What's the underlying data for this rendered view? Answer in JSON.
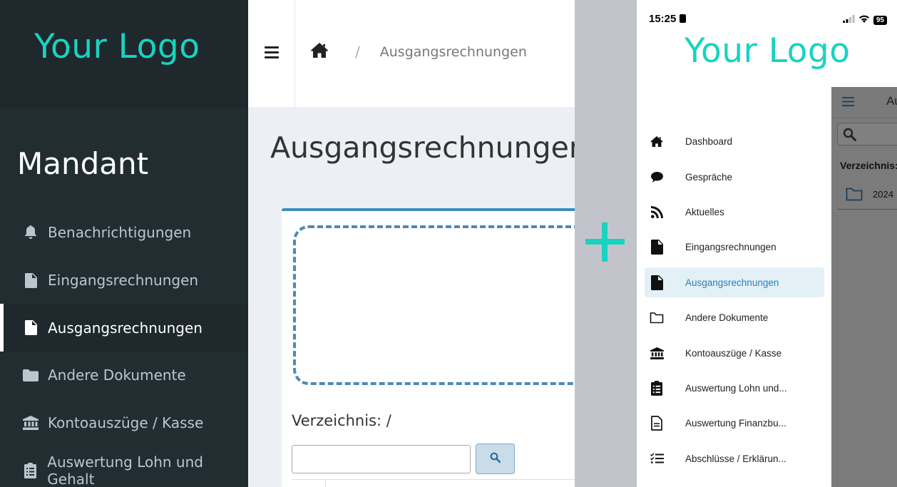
{
  "desktop": {
    "logo": "Your Logo",
    "tenant": "Mandant",
    "nav": [
      {
        "label": "Benachrichtigungen",
        "icon": "bell-icon"
      },
      {
        "label": "Eingangsrechnungen",
        "icon": "file-text-icon"
      },
      {
        "label": "Ausgangsrechnungen",
        "icon": "file-text-icon",
        "active": true
      },
      {
        "label": "Andere Dokumente",
        "icon": "folder-icon"
      },
      {
        "label": "Kontoauszüge / Kasse",
        "icon": "bank-icon"
      },
      {
        "label": "Auswertung Lohn und Gehalt",
        "icon": "clipboard-list-icon"
      }
    ],
    "breadcrumb": {
      "separator": "/",
      "current": "Ausgangsrechnungen"
    },
    "page_title": "Ausgangsrechnungen",
    "directory_label": "Verzeichnis: /",
    "search": {
      "value": "",
      "placeholder": ""
    }
  },
  "phone": {
    "status": {
      "time": "15:25",
      "battery": "95"
    },
    "logo": "Your Logo",
    "nav": [
      {
        "label": "Dashboard",
        "icon": "home-icon"
      },
      {
        "label": "Gespräche",
        "icon": "chat-bubble-icon"
      },
      {
        "label": "Aktuelles",
        "icon": "rss-icon"
      },
      {
        "label": "Eingangsrechnungen",
        "icon": "file-text-icon"
      },
      {
        "label": "Ausgangsrechnungen",
        "icon": "file-text-icon",
        "active": true
      },
      {
        "label": "Andere Dokumente",
        "icon": "folder-outline-icon"
      },
      {
        "label": "Kontoauszüge / Kasse",
        "icon": "bank-icon"
      },
      {
        "label": "Auswertung Lohn und...",
        "icon": "clipboard-list-icon"
      },
      {
        "label": "Auswertung Finanzbu...",
        "icon": "file-outline-icon"
      },
      {
        "label": "Abschlüsse / Erklärun...",
        "icon": "checklist-icon"
      }
    ],
    "background_page": {
      "title_fragment": "Au",
      "directory_fragment": "Verzeichnis:",
      "row_fragment": "2024"
    }
  },
  "colors": {
    "accent": "#19d3c0",
    "sidebar": "#222d32",
    "primary": "#3c8dbc"
  }
}
